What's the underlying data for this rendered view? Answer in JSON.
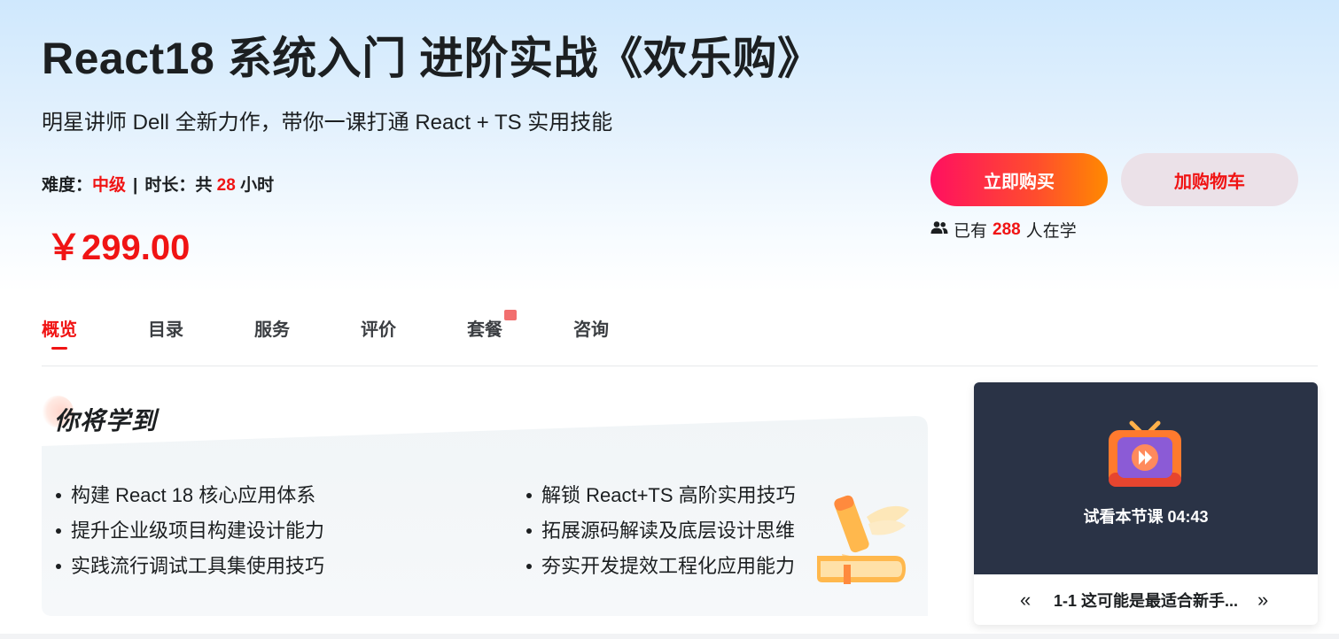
{
  "course": {
    "title": "React18 系统入门 进阶实战《欢乐购》",
    "subtitle": "明星讲师 Dell 全新力作，带你一课打通 React + TS 实用技能",
    "difficulty_label": "难度：",
    "difficulty_value": "中级",
    "separator": "|",
    "duration_label": "时长：共",
    "duration_value": "28",
    "duration_unit": "小时",
    "price": "￥299.00"
  },
  "actions": {
    "buy_label": "立即购买",
    "cart_label": "加购物车"
  },
  "learners": {
    "prefix": "已有",
    "count": "288",
    "suffix": "人在学"
  },
  "tabs": [
    {
      "label": "概览",
      "active": true
    },
    {
      "label": "目录"
    },
    {
      "label": "服务"
    },
    {
      "label": "评价"
    },
    {
      "label": "套餐",
      "badge": true
    },
    {
      "label": "咨询"
    }
  ],
  "learn": {
    "title": "你将学到",
    "left_items": [
      "构建 React 18 核心应用体系",
      "提升企业级项目构建设计能力",
      "实践流行调试工具集使用技巧"
    ],
    "right_items": [
      "解锁 React+TS 高阶实用技巧",
      "拓展源码解读及底层设计思维",
      "夯实开发提效工程化应用能力"
    ]
  },
  "video": {
    "trial_label": "试看本节课 04:43",
    "chapter_title": "1-1 这可能是最适合新手...",
    "prev_symbol": "«",
    "next_symbol": "»"
  },
  "colors": {
    "accent_red": "#f01414",
    "buy_gradient_start": "#ff1060",
    "buy_gradient_end": "#ff8a00",
    "cart_bg": "#ebe1e8",
    "video_bg": "#2a3346"
  }
}
